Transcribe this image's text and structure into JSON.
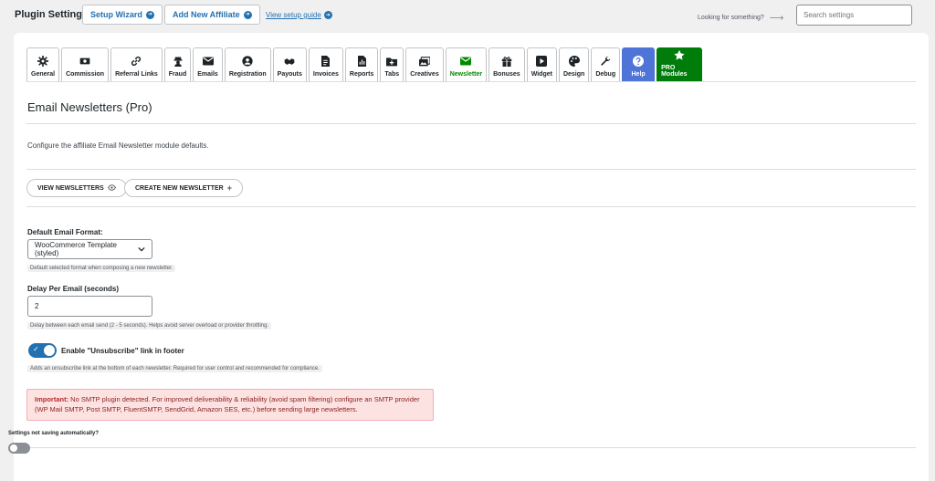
{
  "header": {
    "title": "Plugin Settings",
    "setup_wizard": "Setup Wizard",
    "add_affiliate": "Add New Affiliate",
    "setup_guide": "View setup guide",
    "looking": "Looking for something?",
    "search_placeholder": "Search settings"
  },
  "tabs": [
    {
      "label": "General",
      "icon": "gear-icon"
    },
    {
      "label": "Commission",
      "icon": "money-icon"
    },
    {
      "label": "Referral Links",
      "icon": "link-icon"
    },
    {
      "label": "Fraud",
      "icon": "fraud-icon"
    },
    {
      "label": "Emails",
      "icon": "envelope-icon"
    },
    {
      "label": "Registration",
      "icon": "user-circle-icon"
    },
    {
      "label": "Payouts",
      "icon": "handshake-icon"
    },
    {
      "label": "Invoices",
      "icon": "invoice-icon"
    },
    {
      "label": "Reports",
      "icon": "report-icon"
    },
    {
      "label": "Tabs",
      "icon": "folder-plus-icon"
    },
    {
      "label": "Creatives",
      "icon": "images-icon"
    },
    {
      "label": "Newsletter",
      "icon": "envelope-icon"
    },
    {
      "label": "Bonuses",
      "icon": "gift-icon"
    },
    {
      "label": "Widget",
      "icon": "play-icon"
    },
    {
      "label": "Design",
      "icon": "palette-icon"
    },
    {
      "label": "Debug",
      "icon": "wrench-icon"
    },
    {
      "label": "Help",
      "icon": "question-icon"
    },
    {
      "label": "PRO Modules",
      "icon": "star-icon"
    }
  ],
  "active_tab": "Newsletter",
  "colors": {
    "accent": "#2271b1",
    "active_tab": "#008a00",
    "help": "#4f74d8",
    "pro": "#007c0b",
    "notice_bg": "#fde2e2"
  },
  "section": {
    "title": "Email Newsletters (Pro)",
    "description": "Configure the affiliate Email Newsletter module defaults.",
    "view_button": "VIEW NEWSLETTERS",
    "create_button": "CREATE NEW NEWSLETTER"
  },
  "fields": {
    "format_label": "Default Email Format:",
    "format_value": "WooCommerce Template (styled)",
    "format_hint": "Default selected format when composing a new newsletter.",
    "delay_label": "Delay Per Email (seconds)",
    "delay_value": "2",
    "delay_hint": "Delay between each email send (2 - 5 seconds). Helps avoid server overload or provider throttling.",
    "unsub_label": "Enable \"Unsubscribe\" link in footer",
    "unsub_on": true,
    "unsub_hint": "Adds an unsubscribe link at the bottom of each newsletter. Required for user control and recommended for compliance."
  },
  "notice": {
    "strong": "Important:",
    "text": " No SMTP plugin detected. For improved deliverability & reliability (avoid spam filtering) configure an SMTP provider (WP Mail SMTP, Post SMTP, FluentSMTP, SendGrid, Amazon SES, etc.) before sending large newsletters."
  },
  "footer": {
    "not_saving": "Settings not saving automatically?"
  }
}
